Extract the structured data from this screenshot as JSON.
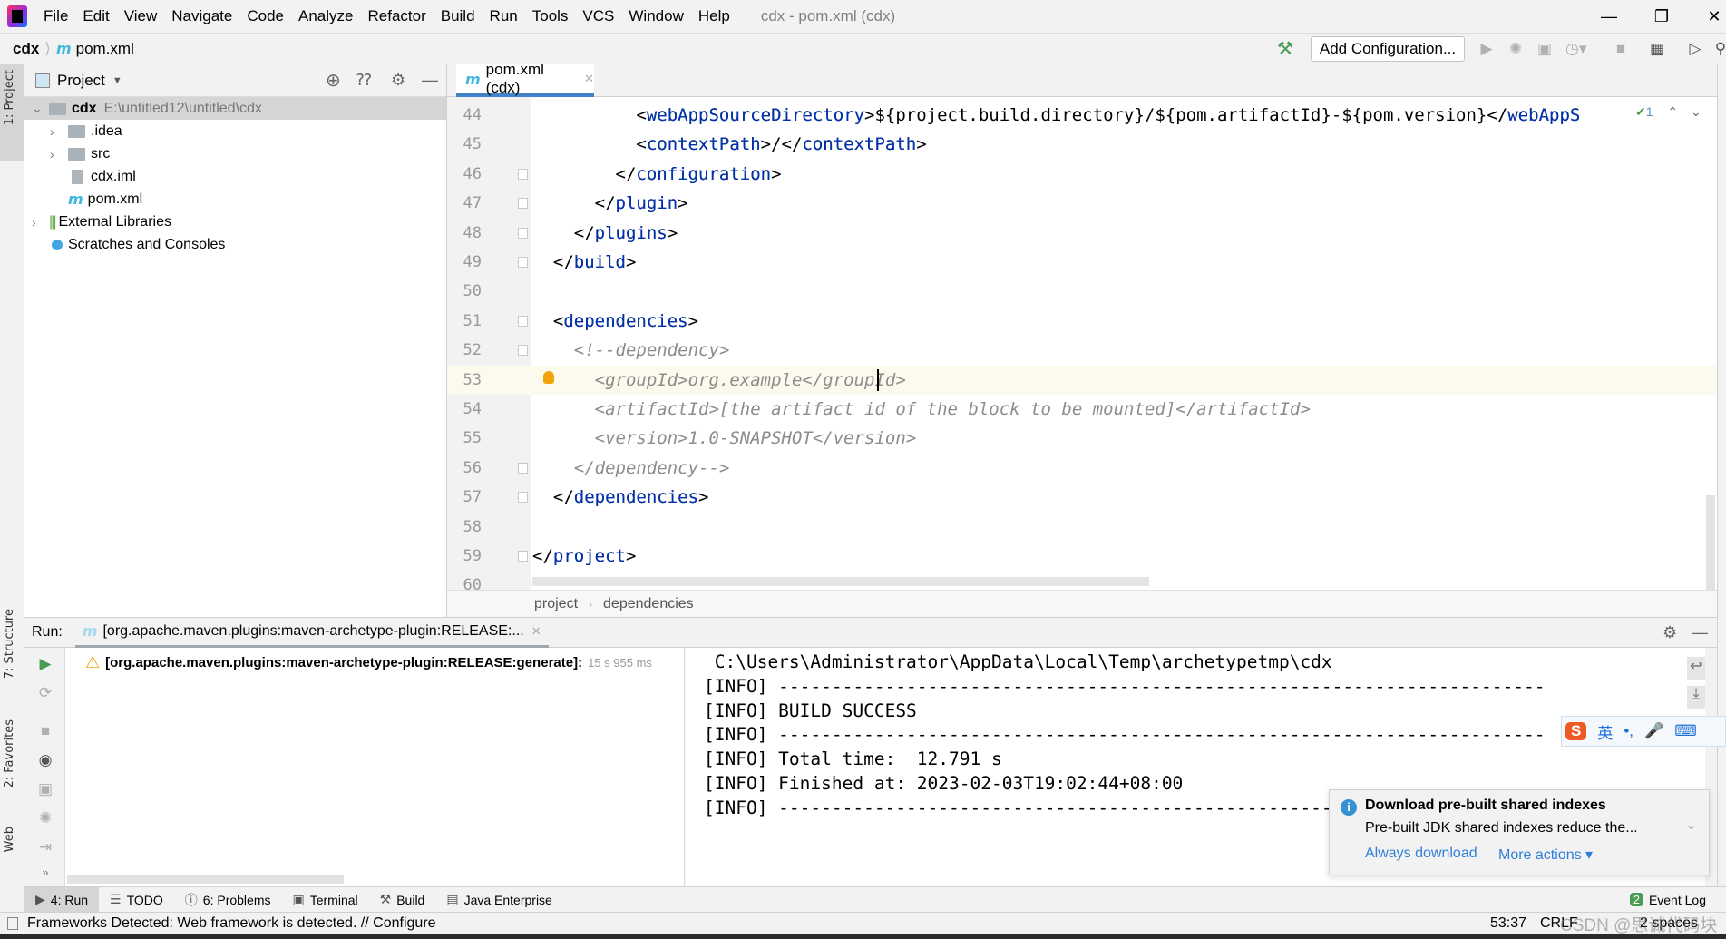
{
  "menubar": {
    "items": [
      "File",
      "Edit",
      "View",
      "Navigate",
      "Code",
      "Analyze",
      "Refactor",
      "Build",
      "Run",
      "Tools",
      "VCS",
      "Window",
      "Help"
    ],
    "window_title": "cdx - pom.xml (cdx)"
  },
  "navbar": {
    "project": "cdx",
    "file": "pom.xml",
    "add_configuration": "Add Configuration..."
  },
  "left_stripe": {
    "project": "1: Project",
    "structure": "7: Structure",
    "favorites": "2: Favorites",
    "web": "Web"
  },
  "project_panel": {
    "title": "Project",
    "tree": [
      {
        "name": "cdx",
        "path": "E:\\untitled12\\untitled\\cdx"
      },
      {
        "name": ".idea"
      },
      {
        "name": "src"
      },
      {
        "name": "cdx.iml"
      },
      {
        "name": "pom.xml"
      },
      {
        "name": "External Libraries"
      },
      {
        "name": "Scratches and Consoles"
      }
    ]
  },
  "editor": {
    "tab": "pom.xml (cdx)",
    "inspection_count": "1",
    "current_line": 53,
    "lines": [
      {
        "n": "44",
        "indent": 10,
        "text": "<webAppSourceDirectory>${project.build.directory}/${pom.artifactId}-${pom.version}</webAppS",
        "kind": "xml"
      },
      {
        "n": "45",
        "indent": 10,
        "text": "<contextPath>/</contextPath>",
        "kind": "xml"
      },
      {
        "n": "46",
        "indent": 8,
        "text": "</configuration>",
        "kind": "xml"
      },
      {
        "n": "47",
        "indent": 6,
        "text": "</plugin>",
        "kind": "xml"
      },
      {
        "n": "48",
        "indent": 4,
        "text": "</plugins>",
        "kind": "xml"
      },
      {
        "n": "49",
        "indent": 2,
        "text": "</build>",
        "kind": "xml"
      },
      {
        "n": "50",
        "indent": 0,
        "text": "",
        "kind": "xml"
      },
      {
        "n": "51",
        "indent": 2,
        "text": "<dependencies>",
        "kind": "xml"
      },
      {
        "n": "52",
        "indent": 4,
        "text": "<!--dependency>",
        "kind": "comment"
      },
      {
        "n": "53",
        "indent": 6,
        "text": "<groupId>org.example</groupId>",
        "kind": "comment"
      },
      {
        "n": "54",
        "indent": 6,
        "text": "<artifactId>[the artifact id of the block to be mounted]</artifactId>",
        "kind": "comment"
      },
      {
        "n": "55",
        "indent": 6,
        "text": "<version>1.0-SNAPSHOT</version>",
        "kind": "comment"
      },
      {
        "n": "56",
        "indent": 4,
        "text": "</dependency-->",
        "kind": "comment"
      },
      {
        "n": "57",
        "indent": 2,
        "text": "</dependencies>",
        "kind": "xml"
      },
      {
        "n": "58",
        "indent": 0,
        "text": "",
        "kind": "xml"
      },
      {
        "n": "59",
        "indent": 0,
        "text": "</project>",
        "kind": "xml"
      },
      {
        "n": "60",
        "indent": 0,
        "text": "",
        "kind": "xml"
      }
    ],
    "breadcrumbs": [
      "project",
      "dependencies"
    ]
  },
  "run_panel": {
    "label": "Run:",
    "tab": "[org.apache.maven.plugins:maven-archetype-plugin:RELEASE:...",
    "task": "[org.apache.maven.plugins:maven-archetype-plugin:RELEASE:generate]:",
    "duration": "15 s 955 ms",
    "console": [
      " C:\\Users\\Administrator\\AppData\\Local\\Temp\\archetypetmp\\cdx",
      "[INFO] ------------------------------------------------------------------------",
      "[INFO] BUILD SUCCESS",
      "[INFO] ------------------------------------------------------------------------",
      "[INFO] Total time:  12.791 s",
      "[INFO] Finished at: 2023-02-03T19:02:44+08:00",
      "[INFO] ------------------------------------------------------------------------"
    ]
  },
  "notification": {
    "title": "Download pre-built shared indexes",
    "body": "Pre-built JDK shared indexes reduce the...",
    "action_primary": "Always download",
    "action_more": "More actions"
  },
  "ime": {
    "mode": "英"
  },
  "bottom_tools": [
    {
      "label": "4: Run",
      "icon": "play-icon"
    },
    {
      "label": "TODO",
      "icon": "list-icon"
    },
    {
      "label": "6: Problems",
      "icon": "warning-icon"
    },
    {
      "label": "Terminal",
      "icon": "terminal-icon"
    },
    {
      "label": "Build",
      "icon": "hammer-icon"
    },
    {
      "label": "Java Enterprise",
      "icon": "java-enterprise-icon"
    }
  ],
  "event_log": {
    "count": "2",
    "label": "Event Log"
  },
  "status": {
    "message": "Frameworks Detected: Web framework is detected. // Configure",
    "position": "53:37",
    "line_sep": "CRLF",
    "indent": "2 spaces",
    "watermark": "CSDN @思诚代码块"
  },
  "colors": {
    "accent": "#4083c9",
    "tag": "#0033b3",
    "comment": "#8c8c8c",
    "current_line": "#fcfaed",
    "run_green": "#499c54",
    "link": "#2f7ed8"
  }
}
